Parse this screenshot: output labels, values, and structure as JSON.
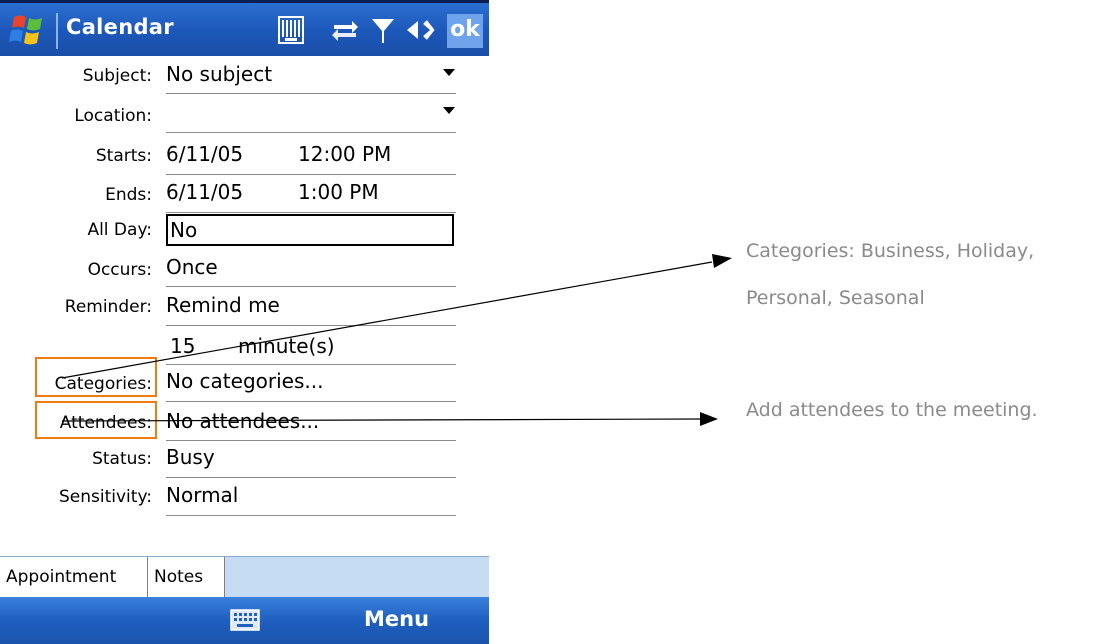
{
  "titlebar": {
    "app_title": "Calendar",
    "icons": [
      "windows-start-icon",
      "sip-keyboard-status-icon",
      "connectivity-icon",
      "signal-icon",
      "volume-icon"
    ],
    "ok_label": "ok",
    "color": "#1c57b8"
  },
  "form": {
    "subject": {
      "label": "Subject:",
      "value": "No subject"
    },
    "location": {
      "label": "Location:",
      "value": ""
    },
    "starts": {
      "label": "Starts:",
      "date": "6/11/05",
      "time": "12:00 PM"
    },
    "ends": {
      "label": "Ends:",
      "date": "6/11/05",
      "time": "1:00 PM"
    },
    "all_day": {
      "label": "All Day:",
      "value": "No"
    },
    "occurs": {
      "label": "Occurs:",
      "value": "Once"
    },
    "reminder": {
      "label": "Reminder:",
      "value": "Remind me",
      "amount": "15",
      "unit": "minute(s)"
    },
    "categories": {
      "label": "Categories:",
      "value": "No categories..."
    },
    "attendees": {
      "label": "Attendees:",
      "value": "No attendees..."
    },
    "status": {
      "label": "Status:",
      "value": "Busy"
    },
    "sensitivity": {
      "label": "Sensitivity:",
      "value": "Normal"
    }
  },
  "tabs": [
    {
      "label": "Appointment",
      "active": true
    },
    {
      "label": "Notes",
      "active": false
    }
  ],
  "softkeys": {
    "left_icon": "keyboard-icon",
    "right_label": "Menu",
    "color": "#1f5fbf"
  },
  "annotations": {
    "categories_note_line1": "Categories: Business, Holiday,",
    "categories_note_line2": "Personal, Seasonal",
    "attendees_note": "Add attendees to the meeting.",
    "highlight_color": "#f07a14"
  }
}
